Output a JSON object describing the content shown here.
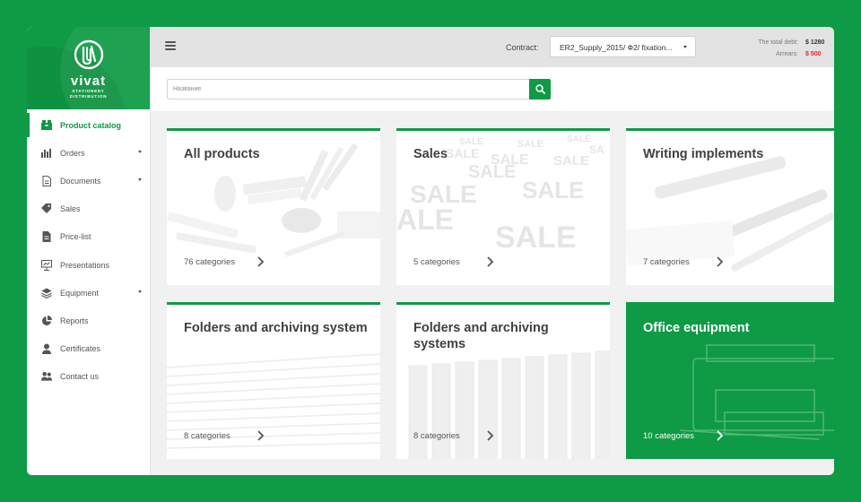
{
  "brand": {
    "name": "vivat",
    "tagline_line1": "STATIONERY",
    "tagline_line2": "DISTRIBUTION",
    "color": "#0f9a45"
  },
  "sidebar": {
    "items": [
      {
        "label": "Product catalog",
        "icon": "box-icon",
        "active": true,
        "has_submenu": false
      },
      {
        "label": "Orders",
        "icon": "bar-chart-icon",
        "active": false,
        "has_submenu": true
      },
      {
        "label": "Documents",
        "icon": "document-icon",
        "active": false,
        "has_submenu": true
      },
      {
        "label": "Sales",
        "icon": "tag-icon",
        "active": false,
        "has_submenu": false
      },
      {
        "label": "Price-list",
        "icon": "file-icon",
        "active": false,
        "has_submenu": false
      },
      {
        "label": "Presentations",
        "icon": "presentation-icon",
        "active": false,
        "has_submenu": false
      },
      {
        "label": "Equipment",
        "icon": "layers-icon",
        "active": false,
        "has_submenu": true
      },
      {
        "label": "Reports",
        "icon": "pie-chart-icon",
        "active": false,
        "has_submenu": false
      },
      {
        "label": "Certificates",
        "icon": "certificate-icon",
        "active": false,
        "has_submenu": false
      },
      {
        "label": "Contact us",
        "icon": "users-icon",
        "active": false,
        "has_submenu": false
      }
    ]
  },
  "header": {
    "contract_label": "Contract:",
    "contract_value": "ER2_Supply_2015/ Ф2/ fixation...",
    "total_debt_label": "The total debt:",
    "total_debt_value": "$ 1280",
    "arrears_label": "Arrears:",
    "arrears_value": "$ 500",
    "arrears_color": "#e12a2a"
  },
  "search": {
    "placeholder": "Название",
    "value": ""
  },
  "cards": [
    {
      "title": "All products",
      "count": "76 categories",
      "bg": "stationery-photo",
      "featured": false
    },
    {
      "title": "Sales",
      "count": "5 categories",
      "bg": "sale-pattern",
      "featured": false
    },
    {
      "title": "Writing implements",
      "count": "7 categories",
      "bg": "pens-photo",
      "featured": false
    },
    {
      "title": "Folders and archiving system",
      "count": "8 categories",
      "bg": "papers-photo",
      "featured": false
    },
    {
      "title": "Folders and archiving systems",
      "count": "8 categories",
      "bg": "binders-photo",
      "featured": false
    },
    {
      "title": "Office equipment",
      "count": "10 categories",
      "bg": "printer-photo",
      "featured": true
    }
  ]
}
